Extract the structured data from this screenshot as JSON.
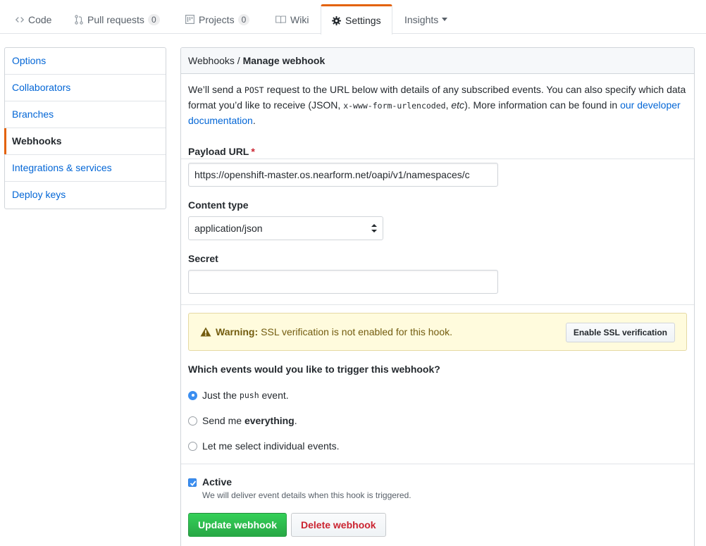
{
  "tabs": {
    "code": "Code",
    "pulls": "Pull requests",
    "pulls_count": "0",
    "projects": "Projects",
    "projects_count": "0",
    "wiki": "Wiki",
    "settings": "Settings",
    "insights": "Insights"
  },
  "sidebar": {
    "items": [
      {
        "label": "Options"
      },
      {
        "label": "Collaborators"
      },
      {
        "label": "Branches"
      },
      {
        "label": "Webhooks"
      },
      {
        "label": "Integrations & services"
      },
      {
        "label": "Deploy keys"
      }
    ]
  },
  "header": {
    "crumb": "Webhooks",
    "separator": "/",
    "title": "Manage webhook"
  },
  "intro": {
    "part1": "We’ll send a",
    "post": "POST",
    "part2": "request to the URL below with details of any subscribed events. You can also specify which data format you’d like to receive (JSON,",
    "urlencoded": "x-www-form-urlencoded",
    "comma": ",",
    "etc": "etc",
    "part3": "). More information can be found in",
    "link": "our developer documentation",
    "period": "."
  },
  "form": {
    "payload_label": "Payload URL",
    "required_mark": "*",
    "payload_value": "https://openshift-master.os.nearform.net/oapi/v1/namespaces/c",
    "content_type_label": "Content type",
    "content_type_value": "application/json",
    "secret_label": "Secret",
    "secret_value": ""
  },
  "warning": {
    "strong": "Warning:",
    "text": "SSL verification is not enabled for this hook.",
    "button": "Enable SSL verification"
  },
  "events": {
    "question": "Which events would you like to trigger this webhook?",
    "option1_pre": "Just the",
    "option1_code": "push",
    "option1_post": "event.",
    "option2_pre": "Send me",
    "option2_strong": "everything",
    "option2_post": ".",
    "option3": "Let me select individual events."
  },
  "active": {
    "label": "Active",
    "note": "We will deliver event details when this hook is triggered."
  },
  "buttons": {
    "update": "Update webhook",
    "delete": "Delete webhook"
  },
  "colors": {
    "accent": "#e36209",
    "link": "#0366d6",
    "primary": "#28a745",
    "danger": "#cb2431"
  }
}
